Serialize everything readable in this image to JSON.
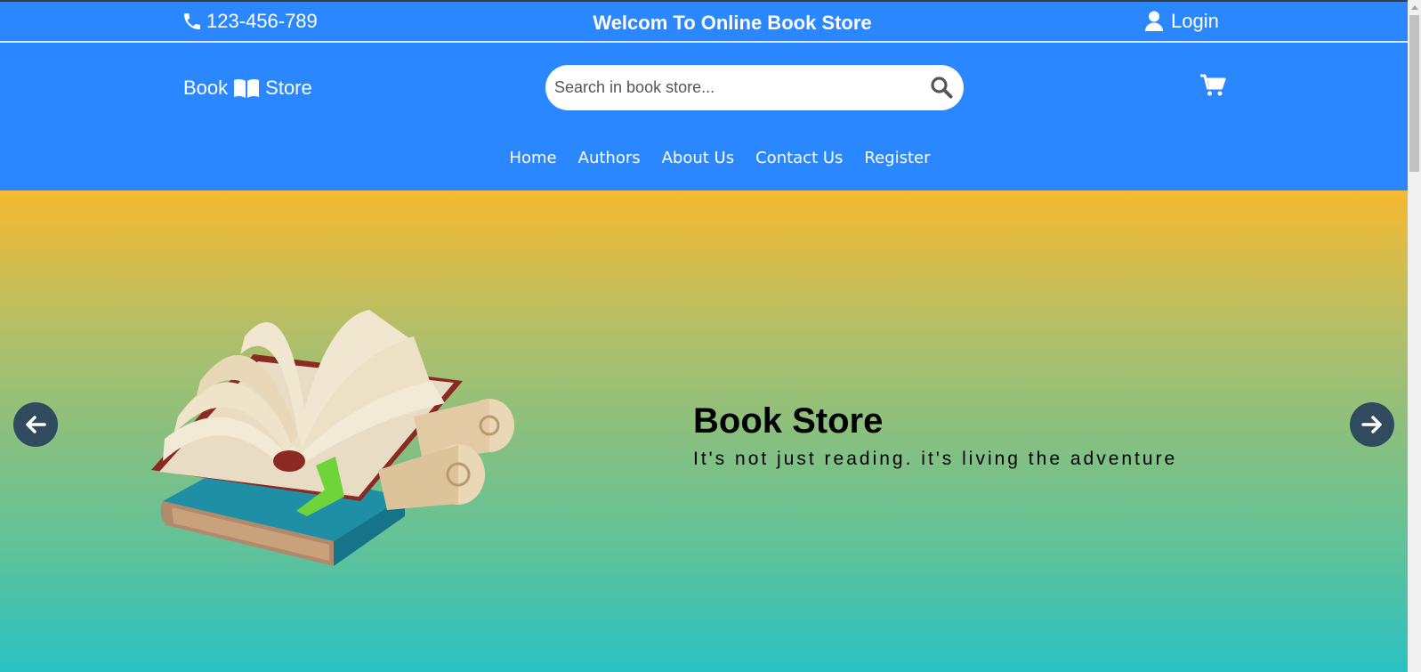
{
  "topbar": {
    "phone": "123-456-789",
    "welcome": "Welcom To Online Book Store",
    "login": "Login"
  },
  "header": {
    "logo_left": "Book",
    "logo_right": "Store",
    "search_placeholder": "Search in book store..."
  },
  "nav": {
    "items": [
      "Home",
      "Authors",
      "About Us",
      "Contact Us",
      "Register"
    ]
  },
  "hero": {
    "title": "Book Store",
    "subtitle": "It's not just reading. it's living the adventure"
  },
  "colors": {
    "brand_blue": "#2b87ff",
    "hero_top": "#f6ba31",
    "hero_bottom": "#2ac2c2",
    "arrow_bg": "#304a5e"
  },
  "icons": [
    "phone-icon",
    "user-icon",
    "book-open-icon",
    "search-icon",
    "cart-icon",
    "arrow-left-icon",
    "arrow-right-icon"
  ]
}
